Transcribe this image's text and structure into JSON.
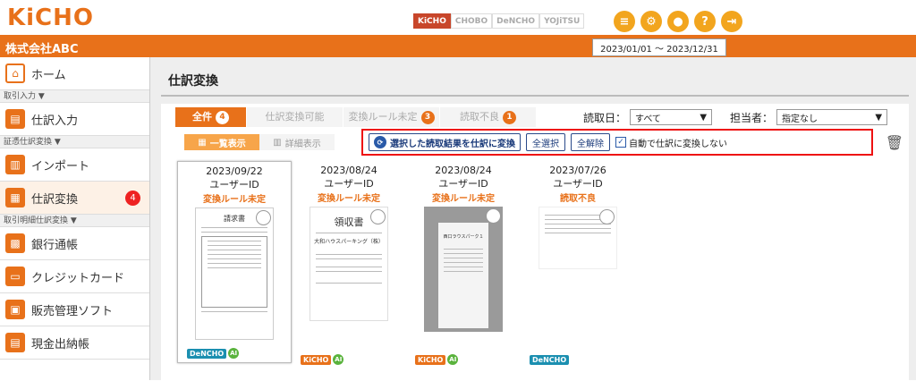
{
  "app": {
    "logo": "KiCHO",
    "company": "株式会社ABC",
    "period": "2023/01/01 〜 2023/12/31"
  },
  "products": [
    "KiCHO",
    "CHOBO",
    "DeNCHO",
    "YOJiTSU"
  ],
  "top_icons": [
    "document-icon",
    "gear-icon",
    "user-icon",
    "help-icon",
    "logout-icon"
  ],
  "sidebar": {
    "home": "ホーム",
    "sec1": "取引入力",
    "item_journal": "仕訳入力",
    "sec2": "証憑仕訳変換",
    "item_import": "インポート",
    "item_convert": "仕訳変換",
    "item_convert_badge": "4",
    "sec3": "取引明細仕訳変換",
    "item_bank": "銀行通帳",
    "item_card": "クレジットカード",
    "item_sales": "販売管理ソフト",
    "item_cash": "現金出納帳"
  },
  "main": {
    "title": "仕訳変換",
    "tabs": [
      {
        "label": "全件",
        "badge": "4"
      },
      {
        "label": "仕訳変換可能",
        "badge": ""
      },
      {
        "label": "変換ルール未定",
        "badge": "3"
      },
      {
        "label": "読取不良",
        "badge": "1"
      }
    ],
    "read_date_label": "読取日：",
    "read_date_value": "すべて",
    "staff_label": "担当者：",
    "staff_value": "指定なし",
    "view_list": "一覧表示",
    "view_detail": "詳細表示",
    "btn_convert": "選択した読取結果を仕訳に変換",
    "btn_select_all": "全選択",
    "btn_deselect_all": "全解除",
    "chk_auto": "自動で仕訳に変換しない"
  },
  "cards": [
    {
      "date": "2023/09/22",
      "user": "ユーザーID",
      "status": "変換ルール未定",
      "product": "DeNCHO",
      "ai": "AI"
    },
    {
      "date": "2023/08/24",
      "user": "ユーザーID",
      "status": "変換ルール未定",
      "product": "KiCHO",
      "ai": "AI"
    },
    {
      "date": "2023/08/24",
      "user": "ユーザーID",
      "status": "変換ルール未定",
      "product": "KiCHO",
      "ai": "AI"
    },
    {
      "date": "2023/07/26",
      "user": "ユーザーID",
      "status": "読取不良",
      "product": "DeNCHO",
      "ai": ""
    }
  ],
  "thumbs": {
    "invoice_title": "請求書",
    "receipt_title": "領収書",
    "receipt_shop": "大和ハウスパーキング（株）",
    "photo_title": "西口ラウスパーク１"
  },
  "colors": {
    "brand": "#e8711a",
    "highlight": "#e11111",
    "accent": "#2a5aa8"
  }
}
